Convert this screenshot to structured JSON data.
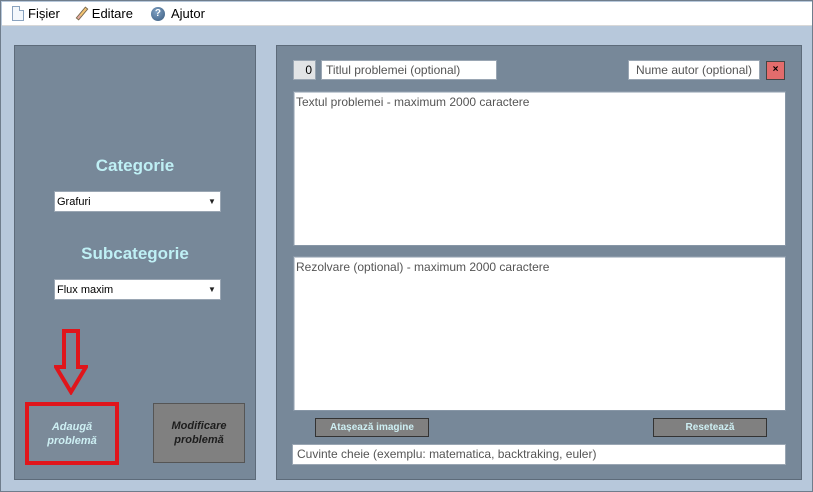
{
  "menubar": {
    "items": [
      {
        "label": "Fișier",
        "icon": "file-icon"
      },
      {
        "label": "Editare",
        "icon": "pencil-icon"
      },
      {
        "label": "Ajutor",
        "icon": "help-icon"
      }
    ]
  },
  "left_panel": {
    "category_title": "Categorie",
    "category_value": "Grafuri",
    "subcategory_title": "Subcategorie",
    "subcategory_value": "Flux maxim",
    "add_button": "Adaugă problemă",
    "edit_button": "Modificare problemă"
  },
  "right_panel": {
    "problem_number": "0",
    "title_placeholder": "Titlul problemei (optional)",
    "author_placeholder": "Nume autor (optional)",
    "close_label": "×",
    "text_placeholder": "Textul problemei - maximum 2000 caractere",
    "solution_placeholder": "Rezolvare (optional) - maximum 2000 caractere",
    "attach_button": "Atașează imagine",
    "reset_button": "Resetează",
    "keywords_placeholder": "Cuvinte cheie (exemplu: matematica, backtraking, euler)"
  },
  "colors": {
    "panel": "#778899",
    "title_text": "#bff0f5",
    "highlight": "#e0151b",
    "close_button": "#e36c6c"
  }
}
